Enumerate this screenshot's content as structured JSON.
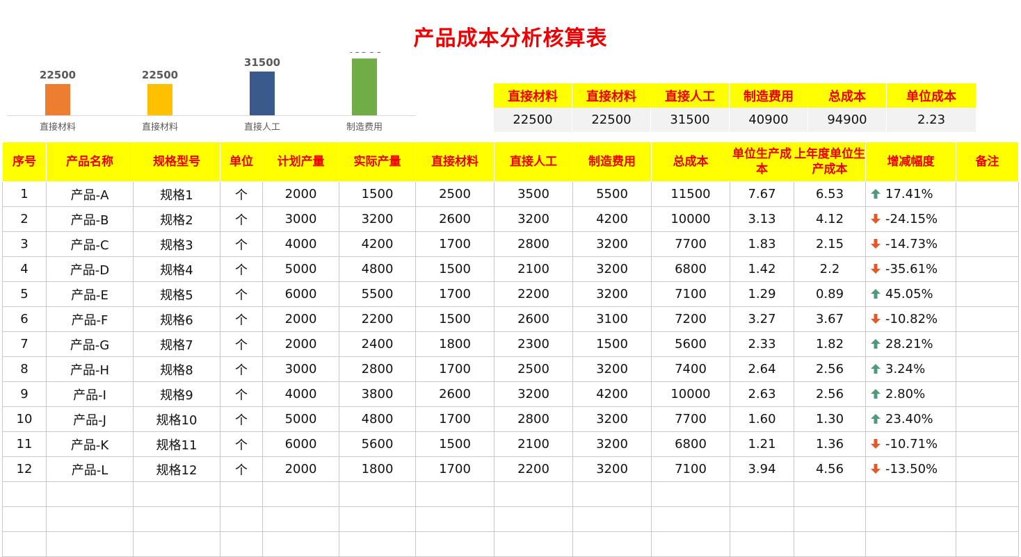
{
  "title": "产品成本分析核算表",
  "colors": {
    "title": "#ee0000",
    "header_bg": "#ffff00",
    "up": "#4f9a7d",
    "down": "#e05a2a"
  },
  "chart_data": {
    "type": "bar",
    "categories": [
      "直接材料",
      "直接材料",
      "直接人工",
      "制造费用"
    ],
    "values": [
      22500,
      22500,
      31500,
      40900
    ],
    "bar_colors": [
      "#ed7d31",
      "#ffc000",
      "#3a5a8c",
      "#70ad47"
    ],
    "ylim": [
      0,
      45000
    ],
    "title": "",
    "xlabel": "",
    "ylabel": ""
  },
  "summary": {
    "headers": [
      "直接材料",
      "直接材料",
      "直接人工",
      "制造费用",
      "总成本",
      "单位成本"
    ],
    "values": [
      "22500",
      "22500",
      "31500",
      "40900",
      "94900",
      "2.23"
    ]
  },
  "table": {
    "headers": [
      "序号",
      "产品名称",
      "规格型号",
      "单位",
      "计划产量",
      "实际产量",
      "直接材料",
      "直接人工",
      "制造费用",
      "总成本",
      "单位生产成本",
      "上年度单位生产成本",
      "增减幅度",
      "备注"
    ],
    "rows": [
      {
        "no": "1",
        "name": "产品-A",
        "spec": "规格1",
        "unit": "个",
        "plan": "2000",
        "actual": "1500",
        "mat": "2500",
        "labor": "3500",
        "mfg": "5500",
        "total": "11500",
        "ucost": "7.67",
        "prev": "6.53",
        "dir": "up",
        "chg": "17.41%",
        "note": ""
      },
      {
        "no": "2",
        "name": "产品-B",
        "spec": "规格2",
        "unit": "个",
        "plan": "3000",
        "actual": "3200",
        "mat": "2600",
        "labor": "3200",
        "mfg": "4200",
        "total": "10000",
        "ucost": "3.13",
        "prev": "4.12",
        "dir": "down",
        "chg": "-24.15%",
        "note": ""
      },
      {
        "no": "3",
        "name": "产品-C",
        "spec": "规格3",
        "unit": "个",
        "plan": "4000",
        "actual": "4200",
        "mat": "1700",
        "labor": "2800",
        "mfg": "3200",
        "total": "7700",
        "ucost": "1.83",
        "prev": "2.15",
        "dir": "down",
        "chg": "-14.73%",
        "note": ""
      },
      {
        "no": "4",
        "name": "产品-D",
        "spec": "规格4",
        "unit": "个",
        "plan": "5000",
        "actual": "4800",
        "mat": "1500",
        "labor": "2100",
        "mfg": "3200",
        "total": "6800",
        "ucost": "1.42",
        "prev": "2.2",
        "dir": "down",
        "chg": "-35.61%",
        "note": ""
      },
      {
        "no": "5",
        "name": "产品-E",
        "spec": "规格5",
        "unit": "个",
        "plan": "6000",
        "actual": "5500",
        "mat": "1700",
        "labor": "2200",
        "mfg": "3200",
        "total": "7100",
        "ucost": "1.29",
        "prev": "0.89",
        "dir": "up",
        "chg": "45.05%",
        "note": ""
      },
      {
        "no": "6",
        "name": "产品-F",
        "spec": "规格6",
        "unit": "个",
        "plan": "2000",
        "actual": "2200",
        "mat": "1500",
        "labor": "2600",
        "mfg": "3100",
        "total": "7200",
        "ucost": "3.27",
        "prev": "3.67",
        "dir": "down",
        "chg": "-10.82%",
        "note": ""
      },
      {
        "no": "7",
        "name": "产品-G",
        "spec": "规格7",
        "unit": "个",
        "plan": "2000",
        "actual": "2400",
        "mat": "1800",
        "labor": "2300",
        "mfg": "1500",
        "total": "5600",
        "ucost": "2.33",
        "prev": "1.82",
        "dir": "up",
        "chg": "28.21%",
        "note": ""
      },
      {
        "no": "8",
        "name": "产品-H",
        "spec": "规格8",
        "unit": "个",
        "plan": "3000",
        "actual": "2800",
        "mat": "1700",
        "labor": "2500",
        "mfg": "3200",
        "total": "7400",
        "ucost": "2.64",
        "prev": "2.56",
        "dir": "up",
        "chg": "3.24%",
        "note": ""
      },
      {
        "no": "9",
        "name": "产品-I",
        "spec": "规格9",
        "unit": "个",
        "plan": "4000",
        "actual": "3800",
        "mat": "2600",
        "labor": "3200",
        "mfg": "4200",
        "total": "10000",
        "ucost": "2.63",
        "prev": "2.56",
        "dir": "up",
        "chg": "2.80%",
        "note": ""
      },
      {
        "no": "10",
        "name": "产品-J",
        "spec": "规格10",
        "unit": "个",
        "plan": "5000",
        "actual": "4800",
        "mat": "1700",
        "labor": "2800",
        "mfg": "3200",
        "total": "7700",
        "ucost": "1.60",
        "prev": "1.30",
        "dir": "up",
        "chg": "23.40%",
        "note": ""
      },
      {
        "no": "11",
        "name": "产品-K",
        "spec": "规格11",
        "unit": "个",
        "plan": "6000",
        "actual": "5600",
        "mat": "1500",
        "labor": "2100",
        "mfg": "3200",
        "total": "6800",
        "ucost": "1.21",
        "prev": "1.36",
        "dir": "down",
        "chg": "-10.71%",
        "note": ""
      },
      {
        "no": "12",
        "name": "产品-L",
        "spec": "规格12",
        "unit": "个",
        "plan": "2000",
        "actual": "1800",
        "mat": "1700",
        "labor": "2200",
        "mfg": "3200",
        "total": "7100",
        "ucost": "3.94",
        "prev": "4.56",
        "dir": "down",
        "chg": "-13.50%",
        "note": ""
      }
    ]
  }
}
